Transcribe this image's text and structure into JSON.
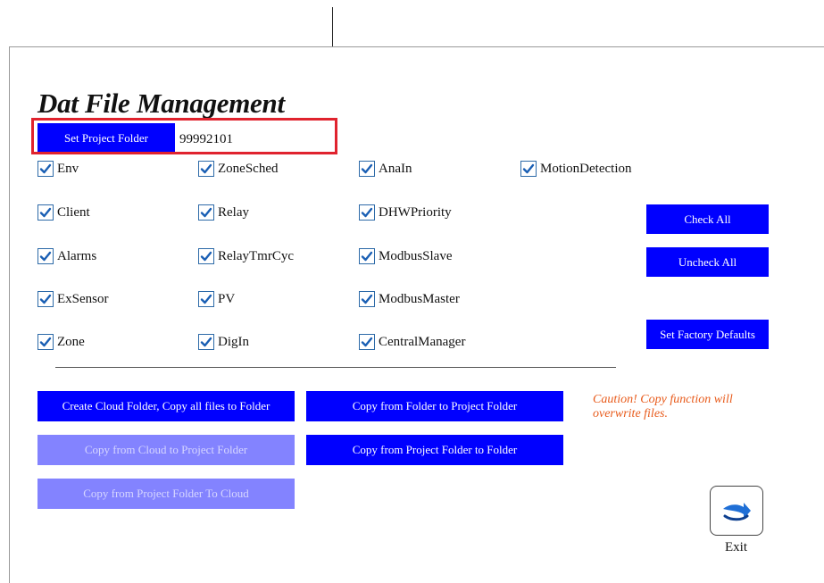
{
  "title": "Dat File Management",
  "project": {
    "button_label": "Set Project Folder",
    "value": "99992101"
  },
  "checkboxes": [
    {
      "label": "Env",
      "checked": true
    },
    {
      "label": "ZoneSched",
      "checked": true
    },
    {
      "label": "AnaIn",
      "checked": true
    },
    {
      "label": "MotionDetection",
      "checked": true
    },
    {
      "label": "Client",
      "checked": true
    },
    {
      "label": "Relay",
      "checked": true
    },
    {
      "label": "DHWPriority",
      "checked": true
    },
    {
      "label": "Alarms",
      "checked": true
    },
    {
      "label": "RelayTmrCyc",
      "checked": true
    },
    {
      "label": "ModbusSlave",
      "checked": true
    },
    {
      "label": "ExSensor",
      "checked": true
    },
    {
      "label": "PV",
      "checked": true
    },
    {
      "label": "ModbusMaster",
      "checked": true
    },
    {
      "label": "Zone",
      "checked": true
    },
    {
      "label": "DigIn",
      "checked": true
    },
    {
      "label": "CentralManager",
      "checked": true
    }
  ],
  "actions": {
    "check_all": "Check All",
    "uncheck_all": "Uncheck All",
    "factory_defaults": "Set Factory Defaults",
    "create_cloud": "Create Cloud Folder, Copy all files to Folder",
    "copy_folder_to_project": "Copy from Folder to Project Folder",
    "copy_cloud_to_project": "Copy from Cloud to Project Folder",
    "copy_project_to_folder": "Copy from Project Folder to Folder",
    "copy_project_to_cloud": "Copy from Project Folder To Cloud"
  },
  "caution": "Caution! Copy function will overwrite files.",
  "exit_label": "Exit",
  "colors": {
    "button": "#0000ff",
    "button_disabled": "#8383ff",
    "caution": "#e85a1a",
    "highlight": "#e0232e"
  }
}
